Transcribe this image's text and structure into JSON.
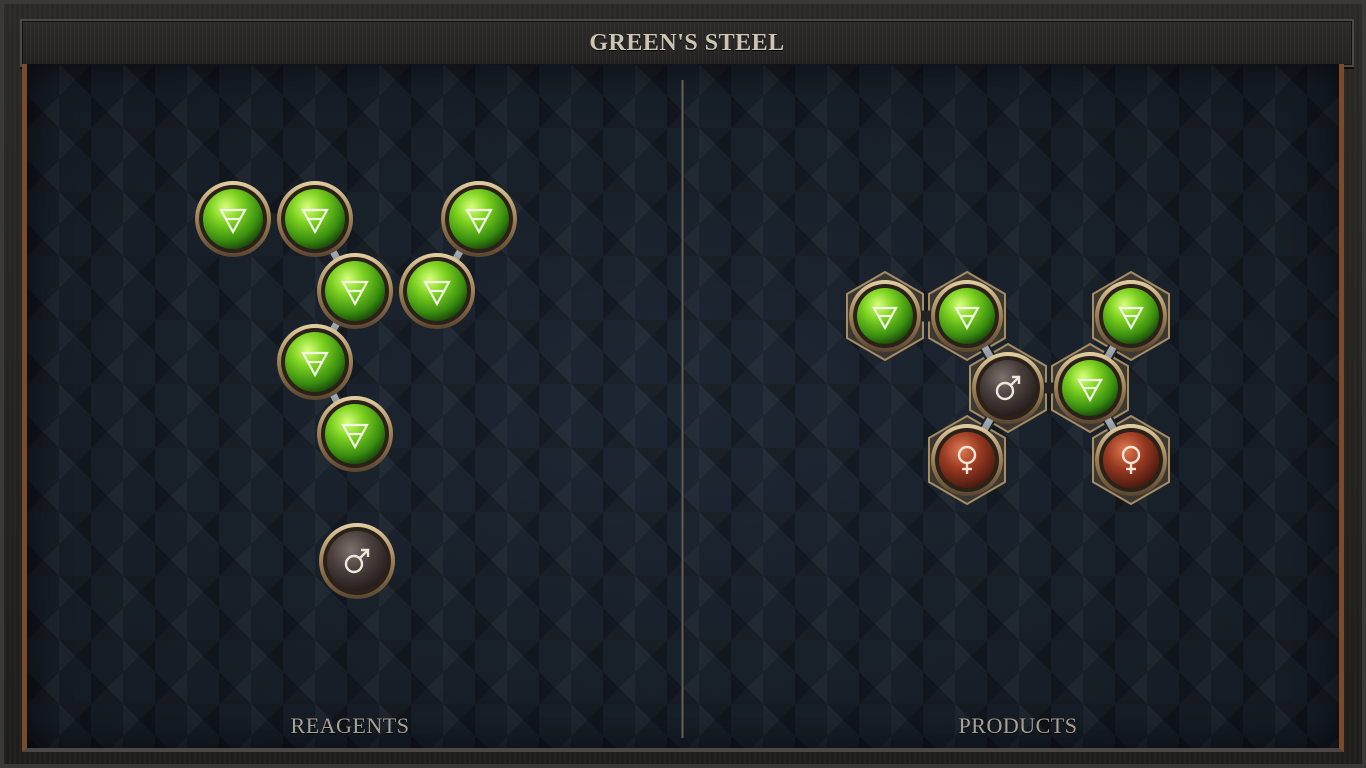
{
  "title": "GREEN'S STEEL",
  "panels": {
    "reagents_label": "REAGENTS",
    "products_label": "PRODUCTS"
  },
  "colors": {
    "earth_atom": "#5fc21d",
    "mars_atom": "#4a3f3d",
    "venus_atom": "#9a3a22",
    "atom_rim": "#b79a6c",
    "board_bg": "#18202b",
    "frame_accent": "#7a4a2a"
  },
  "atom_types": {
    "earth": {
      "icon": "earth-element-icon",
      "glyph": "🜃"
    },
    "mars": {
      "icon": "mars-element-icon",
      "glyph": "♂"
    },
    "venus": {
      "icon": "venus-element-icon",
      "glyph": "♀"
    }
  },
  "reagents": [
    {
      "name": "earth-molecule",
      "atoms": [
        "earth",
        "earth",
        "earth",
        "earth",
        "earth",
        "earth",
        "earth"
      ],
      "bond_count": 6
    },
    {
      "name": "mars-atom",
      "atoms": [
        "mars"
      ],
      "bond_count": 0
    }
  ],
  "products": [
    {
      "name": "greens-steel-molecule",
      "atoms": [
        "earth",
        "earth",
        "earth",
        "earth",
        "mars",
        "venus",
        "venus"
      ],
      "bond_count": 6
    }
  ]
}
